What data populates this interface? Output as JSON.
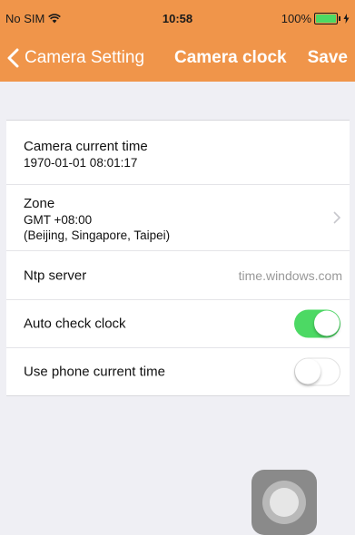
{
  "status_bar": {
    "carrier": "No SIM",
    "time": "10:58",
    "battery": "100%"
  },
  "nav": {
    "back_label": "Camera Setting",
    "title": "Camera clock",
    "save_label": "Save"
  },
  "settings": {
    "camera_time": {
      "label": "Camera current time",
      "value": "1970-01-01 08:01:17"
    },
    "zone": {
      "label": "Zone",
      "offset": "GMT +08:00",
      "cities": "(Beijing, Singapore, Taipei)"
    },
    "ntp": {
      "label": "Ntp server",
      "value": "time.windows.com"
    },
    "auto_check": {
      "label": "Auto check clock",
      "enabled": true
    },
    "use_phone_time": {
      "label": "Use phone current time",
      "enabled": false
    }
  },
  "colors": {
    "accent": "#f0954a",
    "toggle_on": "#4cd964",
    "background": "#efeff4"
  }
}
